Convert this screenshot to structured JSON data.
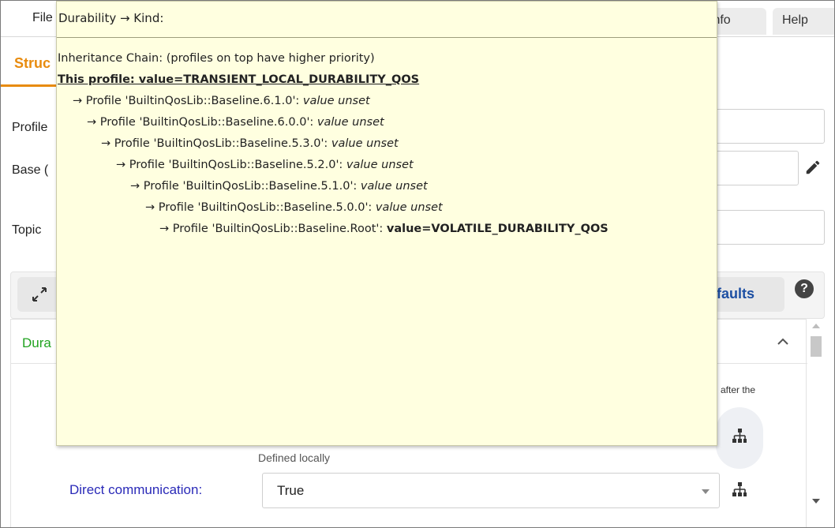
{
  "menu": {
    "file": "File",
    "info": "Info",
    "help": "Help"
  },
  "tabs": {
    "structure": "Struc"
  },
  "form": {
    "profile_label": "Profile",
    "base_label": "Base (",
    "topic_label": "Topic"
  },
  "qos": {
    "defaults_label": "faults",
    "help_glyph": "?",
    "section_title": "Dura",
    "after_text": "after the",
    "defined_locally": "Defined locally",
    "direct_label": "Direct communication:",
    "direct_value": "True"
  },
  "tooltip": {
    "title": "Durability → Kind:",
    "chain_header": "Inheritance Chain: (profiles on top have higher priority)",
    "this_profile": "This profile: value=TRANSIENT_LOCAL_DURABILITY_QOS",
    "chain": [
      {
        "prefix": "→ Profile 'BuiltinQosLib::Baseline.6.1.0': ",
        "value": "value unset"
      },
      {
        "prefix": "→ Profile 'BuiltinQosLib::Baseline.6.0.0': ",
        "value": "value unset"
      },
      {
        "prefix": "→ Profile 'BuiltinQosLib::Baseline.5.3.0': ",
        "value": "value unset"
      },
      {
        "prefix": "→ Profile 'BuiltinQosLib::Baseline.5.2.0': ",
        "value": "value unset"
      },
      {
        "prefix": "→ Profile 'BuiltinQosLib::Baseline.5.1.0': ",
        "value": "value unset"
      },
      {
        "prefix": "→ Profile 'BuiltinQosLib::Baseline.5.0.0': ",
        "value": "value unset"
      },
      {
        "prefix": "→ Profile 'BuiltinQosLib::Baseline.Root': ",
        "value": "value=VOLATILE_DURABILITY_QOS"
      }
    ]
  },
  "colors": {
    "tab_accent": "#e88b0e",
    "section_title": "#21a320",
    "link_blue": "#2a2ab8",
    "tooltip_bg": "#ffffe0"
  },
  "icons": {
    "expand": "expand-arrows-icon",
    "edit": "pencil-icon",
    "help": "help-circle-icon",
    "collapse": "chevron-up-icon",
    "hierarchy": "hierarchy-icon"
  }
}
